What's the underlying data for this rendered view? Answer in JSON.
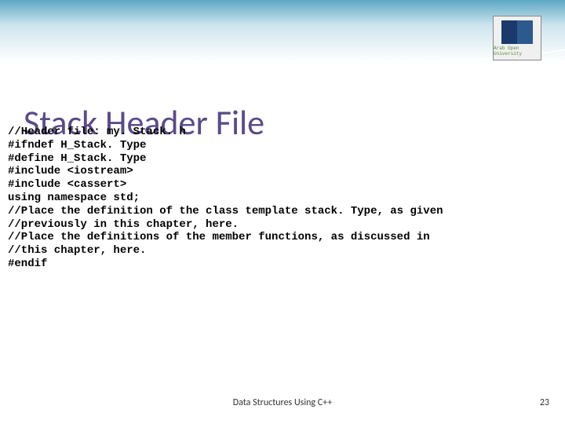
{
  "title": "Stack Header File",
  "code": {
    "line1": "//Header file: my. Stack. h",
    "line2": "",
    "line3": "#ifndef H_Stack. Type",
    "line4": "#define H_Stack. Type",
    "line5": "",
    "line6": "#include <iostream>",
    "line7": "#include <cassert>",
    "line8": "",
    "line9": "using namespace std;",
    "line10": "",
    "line11": "//Place the definition of the class template stack. Type, as given",
    "line12": "//previously in this chapter, here.",
    "line13": "",
    "line14": "//Place the definitions of the member functions, as discussed in",
    "line15": "//this chapter, here.",
    "line16": "#endif"
  },
  "footer": "Data Structures Using C++",
  "page_number": "23"
}
